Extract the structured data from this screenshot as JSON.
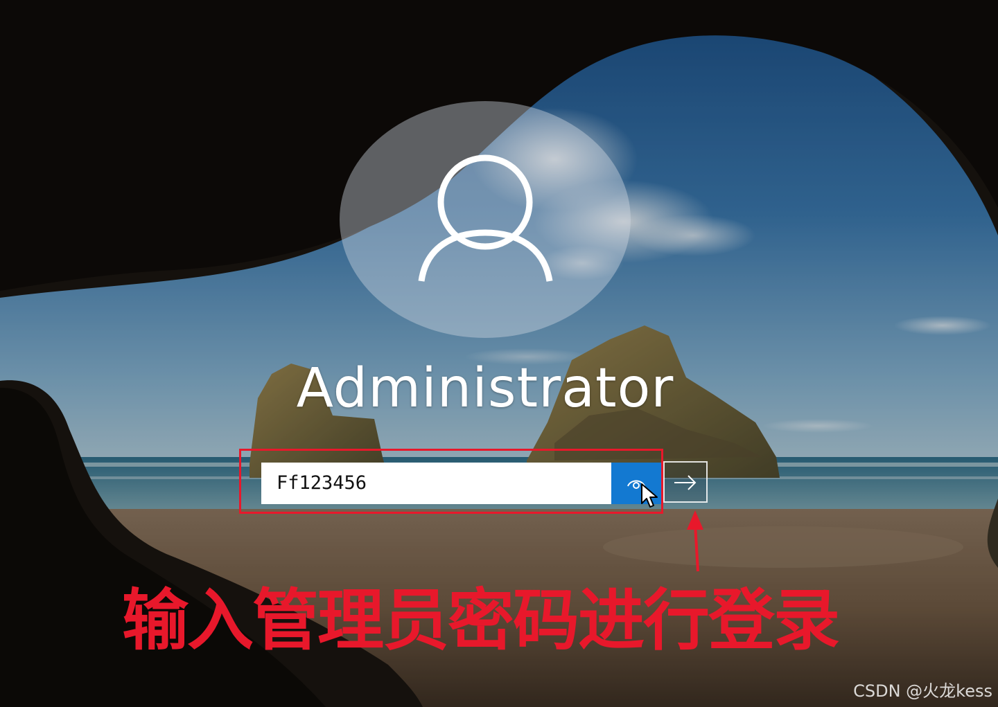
{
  "login": {
    "username": "Administrator",
    "password_value": "Ff123456",
    "reveal_icon": "eye-icon",
    "submit_icon": "arrow-right-icon"
  },
  "annotation": {
    "text": "输入管理员密码进行登录",
    "color": "#e8182b"
  },
  "watermark": {
    "text": "CSDN @火龙kess"
  },
  "colors": {
    "accent": "#1379d1",
    "avatar_bg": "rgba(210,218,226,0.42)"
  }
}
